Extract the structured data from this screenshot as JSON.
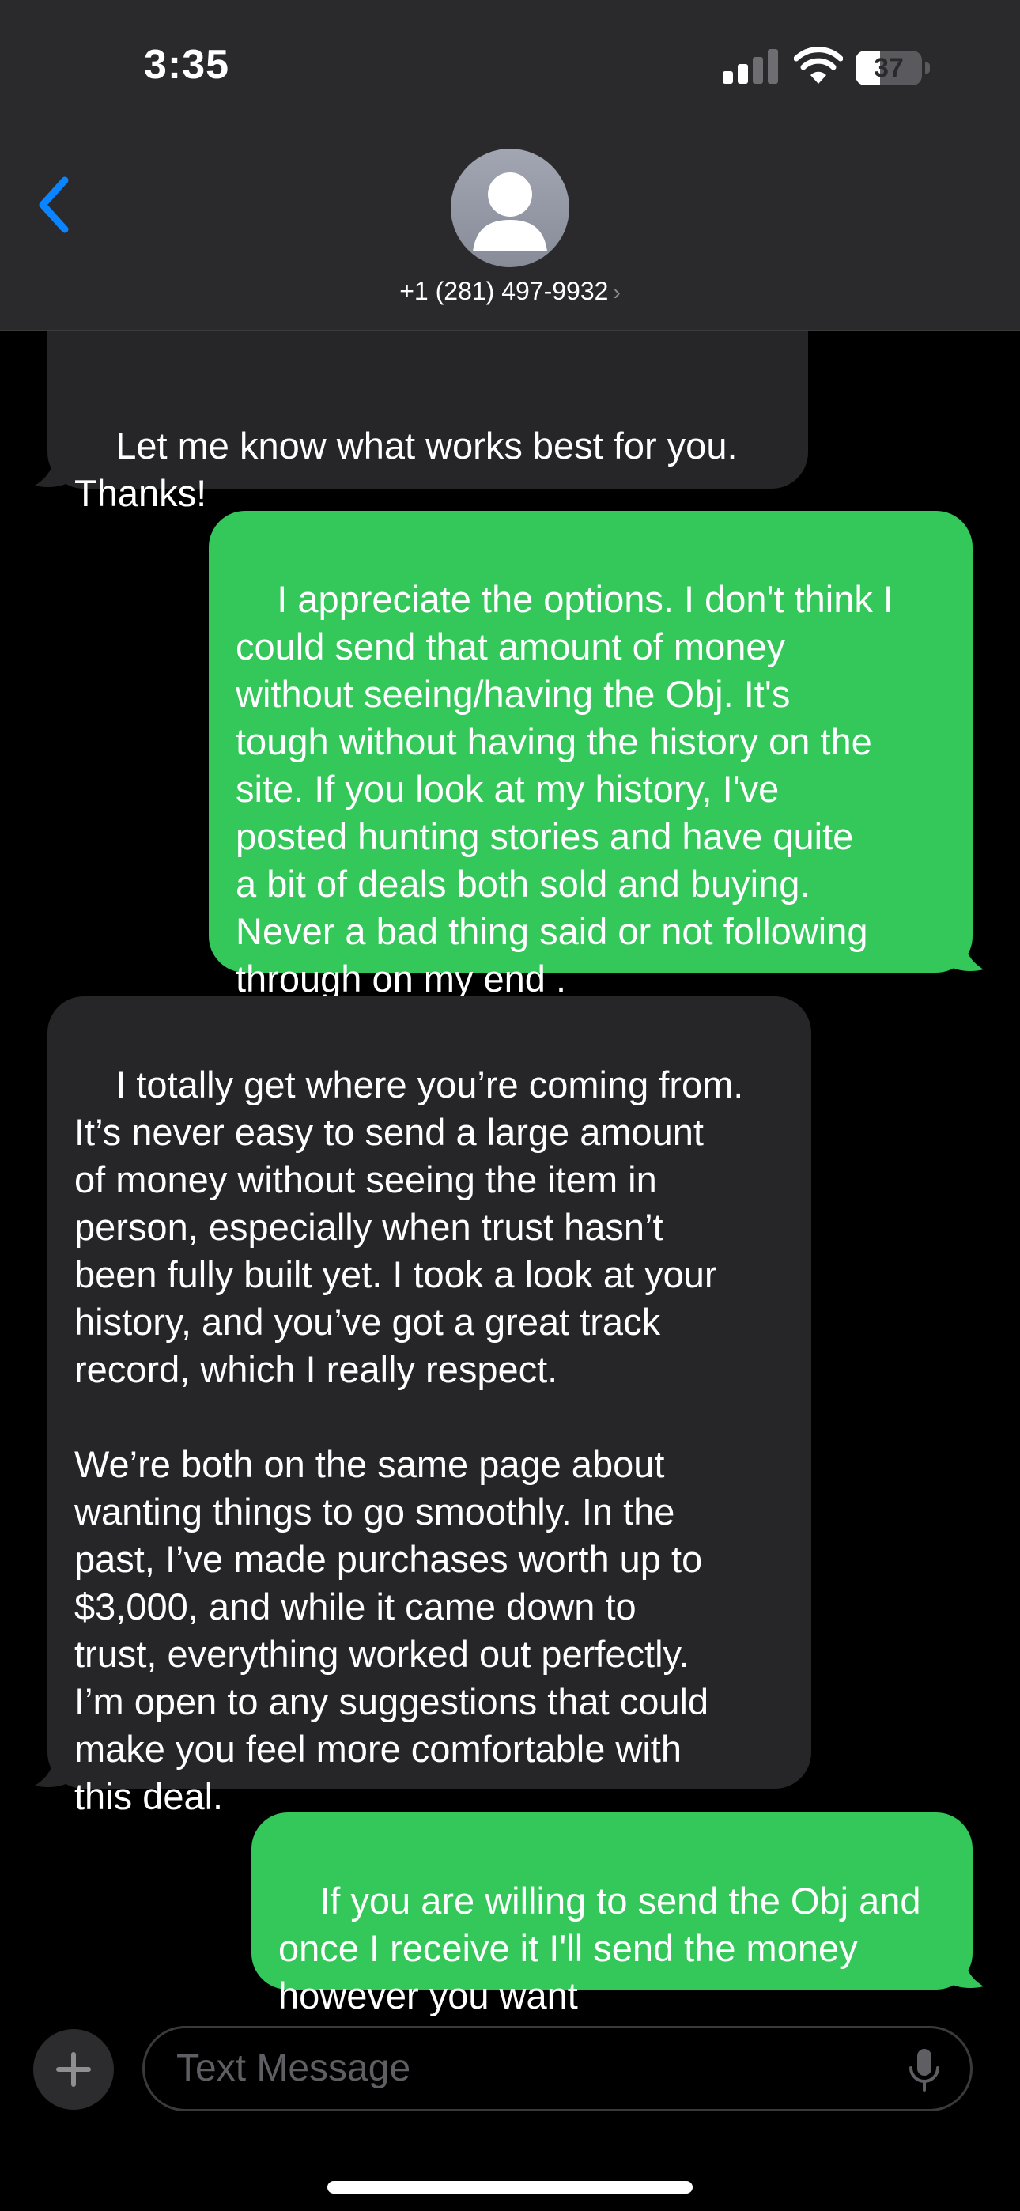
{
  "status_bar": {
    "time": "3:35",
    "battery_level": "37",
    "battery_fraction": 0.37
  },
  "header": {
    "contact": "+1 (281) 497-9932",
    "chevron": "›"
  },
  "messages": [
    {
      "direction": "received",
      "text": "Let me know what works best for you.\nThanks!"
    },
    {
      "direction": "sent",
      "text": "I appreciate the options. I don't think I\ncould send that amount of money\nwithout seeing/having the Obj. It's\ntough without having the history on the\nsite. If you look at my history, I've\nposted hunting stories and have quite\na bit of deals both sold and buying.\nNever a bad thing said or not following\nthrough on my end ."
    },
    {
      "direction": "received",
      "text": "I totally get where you’re coming from.\nIt’s never easy to send a large amount\nof money without seeing the item in\nperson, especially when trust hasn’t\nbeen fully built yet. I took a look at your\nhistory, and you’ve got a great track\nrecord, which I really respect.\n\nWe’re both on the same page about\nwanting things to go smoothly. In the\npast, I’ve made purchases worth up to\n$3,000, and while it came down to\ntrust, everything worked out perfectly.\nI’m open to any suggestions that could\nmake you feel more comfortable with\nthis deal."
    },
    {
      "direction": "sent",
      "text": "If you are willing to send the Obj and\nonce I receive it I'll send the money\nhowever you want"
    }
  ],
  "input": {
    "placeholder": "Text Message"
  },
  "icons": {
    "back": "chevron-left-icon",
    "avatar": "person-icon",
    "add": "plus-icon",
    "mic": "microphone-icon"
  },
  "colors": {
    "sent_bubble": "#34c759",
    "received_bubble": "#262628",
    "accent": "#0a84ff",
    "header_bg": "#2a2a2c"
  }
}
